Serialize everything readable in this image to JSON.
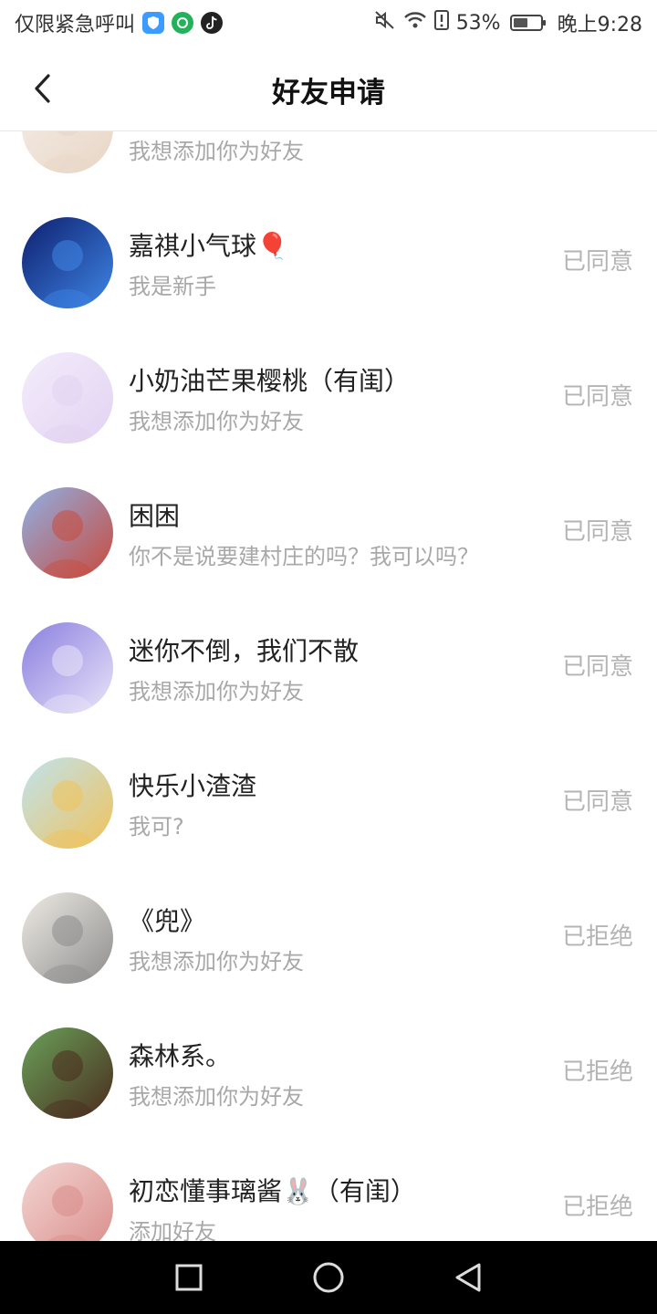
{
  "status_bar": {
    "left_text": "仅限紧急呼叫",
    "battery_percent": "53%",
    "battery_level": 0.53,
    "time": "晚上9:28",
    "icons": [
      "shield-icon",
      "green-app-icon",
      "tiktok-icon",
      "mute-icon",
      "wifi-icon",
      "alert-icon",
      "battery-icon"
    ]
  },
  "header": {
    "title": "好友申请",
    "back_icon": "chevron-left-icon"
  },
  "requests": [
    {
      "name": "",
      "message": "我想添加你为好友",
      "status": "",
      "avatar_colors": [
        "#f5ede6",
        "#e8d6c6"
      ]
    },
    {
      "name": "嘉祺小气球🎈",
      "message": "我是新手",
      "status": "已同意",
      "avatar_colors": [
        "#0d1f6e",
        "#3f86e6"
      ]
    },
    {
      "name": "小奶油芒果樱桃（有闺）",
      "message": "我想添加你为好友",
      "status": "已同意",
      "avatar_colors": [
        "#f4ecfb",
        "#e2d3f2"
      ]
    },
    {
      "name": "困困",
      "message": "你不是说要建村庄的吗？我可以吗？",
      "status": "已同意",
      "avatar_colors": [
        "#8fb0e6",
        "#c94a3c"
      ]
    },
    {
      "name": "迷你不倒，我们不散",
      "message": "我想添加你为好友",
      "status": "已同意",
      "avatar_colors": [
        "#8a7fe0",
        "#e9e4f8"
      ]
    },
    {
      "name": "快乐小渣渣",
      "message": "我可?",
      "status": "已同意",
      "avatar_colors": [
        "#bfe3f0",
        "#f0c25a"
      ]
    },
    {
      "name": "《兜》",
      "message": "我想添加你为好友",
      "status": "已拒绝",
      "avatar_colors": [
        "#eeeae4",
        "#8d8d8d"
      ]
    },
    {
      "name": "森林系。",
      "message": "我想添加你为好友",
      "status": "已拒绝",
      "avatar_colors": [
        "#6aa15a",
        "#4a2c1e"
      ]
    },
    {
      "name": "初恋懂事璃酱🐰（有闺）",
      "message": "添加好友",
      "status": "已拒绝",
      "avatar_colors": [
        "#f3d6d3",
        "#d98d8a"
      ]
    }
  ],
  "navbar": {
    "icons": [
      "recents-square-icon",
      "home-circle-icon",
      "back-triangle-icon"
    ]
  }
}
